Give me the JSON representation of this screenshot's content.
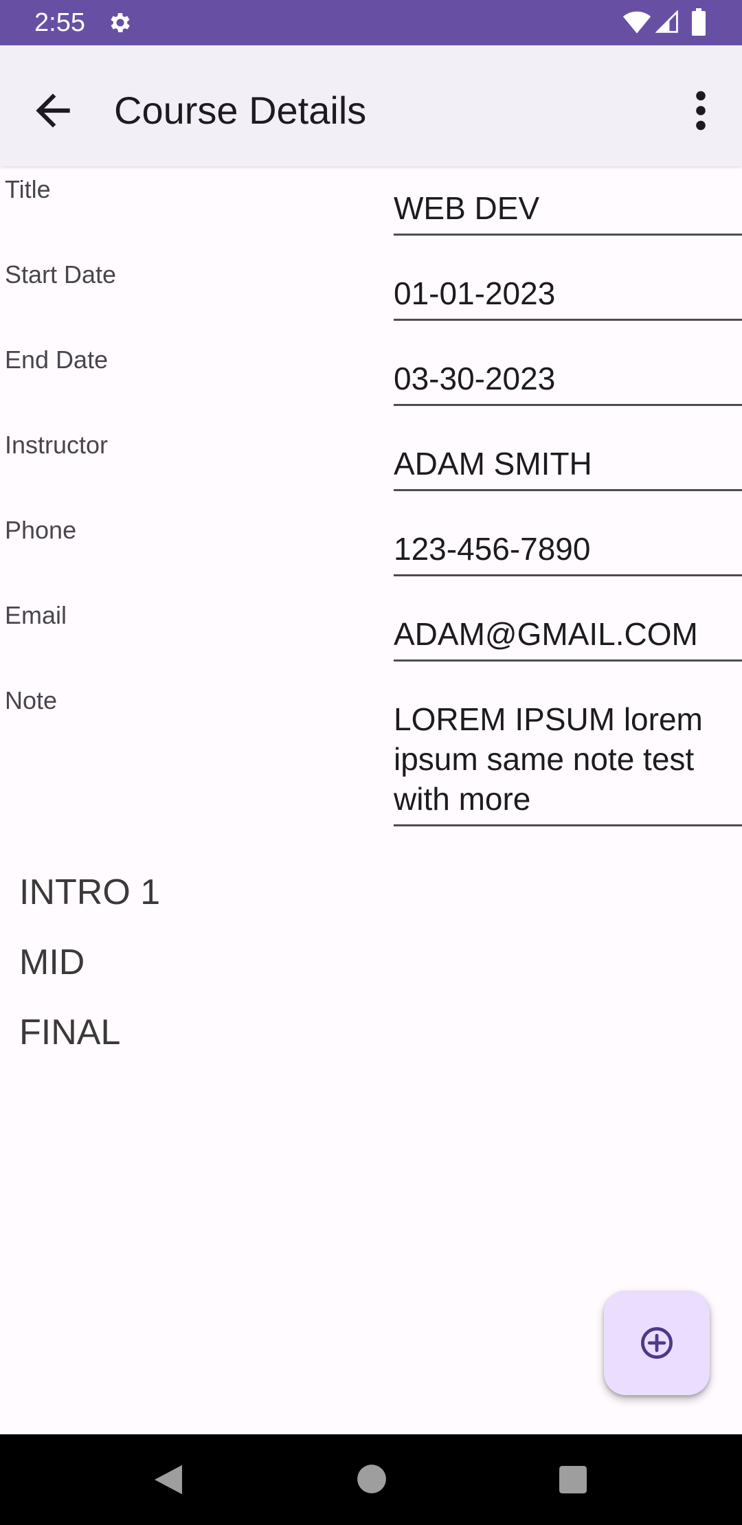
{
  "status_bar": {
    "time": "2:55",
    "icons": [
      "gear-icon",
      "wifi-icon",
      "signal-icon",
      "battery-icon"
    ],
    "background": "#6750a4"
  },
  "app_bar": {
    "title": "Course Details",
    "back_icon": "arrow-back-icon",
    "menu_icon": "more-vert-icon"
  },
  "form": {
    "title": {
      "label": "Title",
      "value": "WEB DEV"
    },
    "start_date": {
      "label": "Start Date",
      "value": "01-01-2023"
    },
    "end_date": {
      "label": "End Date",
      "value": "03-30-2023"
    },
    "instructor": {
      "label": "Instructor",
      "value": "ADAM SMITH"
    },
    "phone": {
      "label": "Phone",
      "value": "123-456-7890"
    },
    "email": {
      "label": "Email",
      "value": "ADAM@GMAIL.COM"
    },
    "note": {
      "label": "Note",
      "value": "LOREM IPSUM lorem ipsum same note test with more"
    }
  },
  "assessments": [
    "INTRO 1",
    "MID",
    "FINAL"
  ],
  "fab": {
    "icon": "add-circle-icon",
    "color": "#eaddff"
  },
  "nav_bar": {
    "icons": [
      "nav-back-icon",
      "nav-home-icon",
      "nav-recents-icon"
    ]
  }
}
